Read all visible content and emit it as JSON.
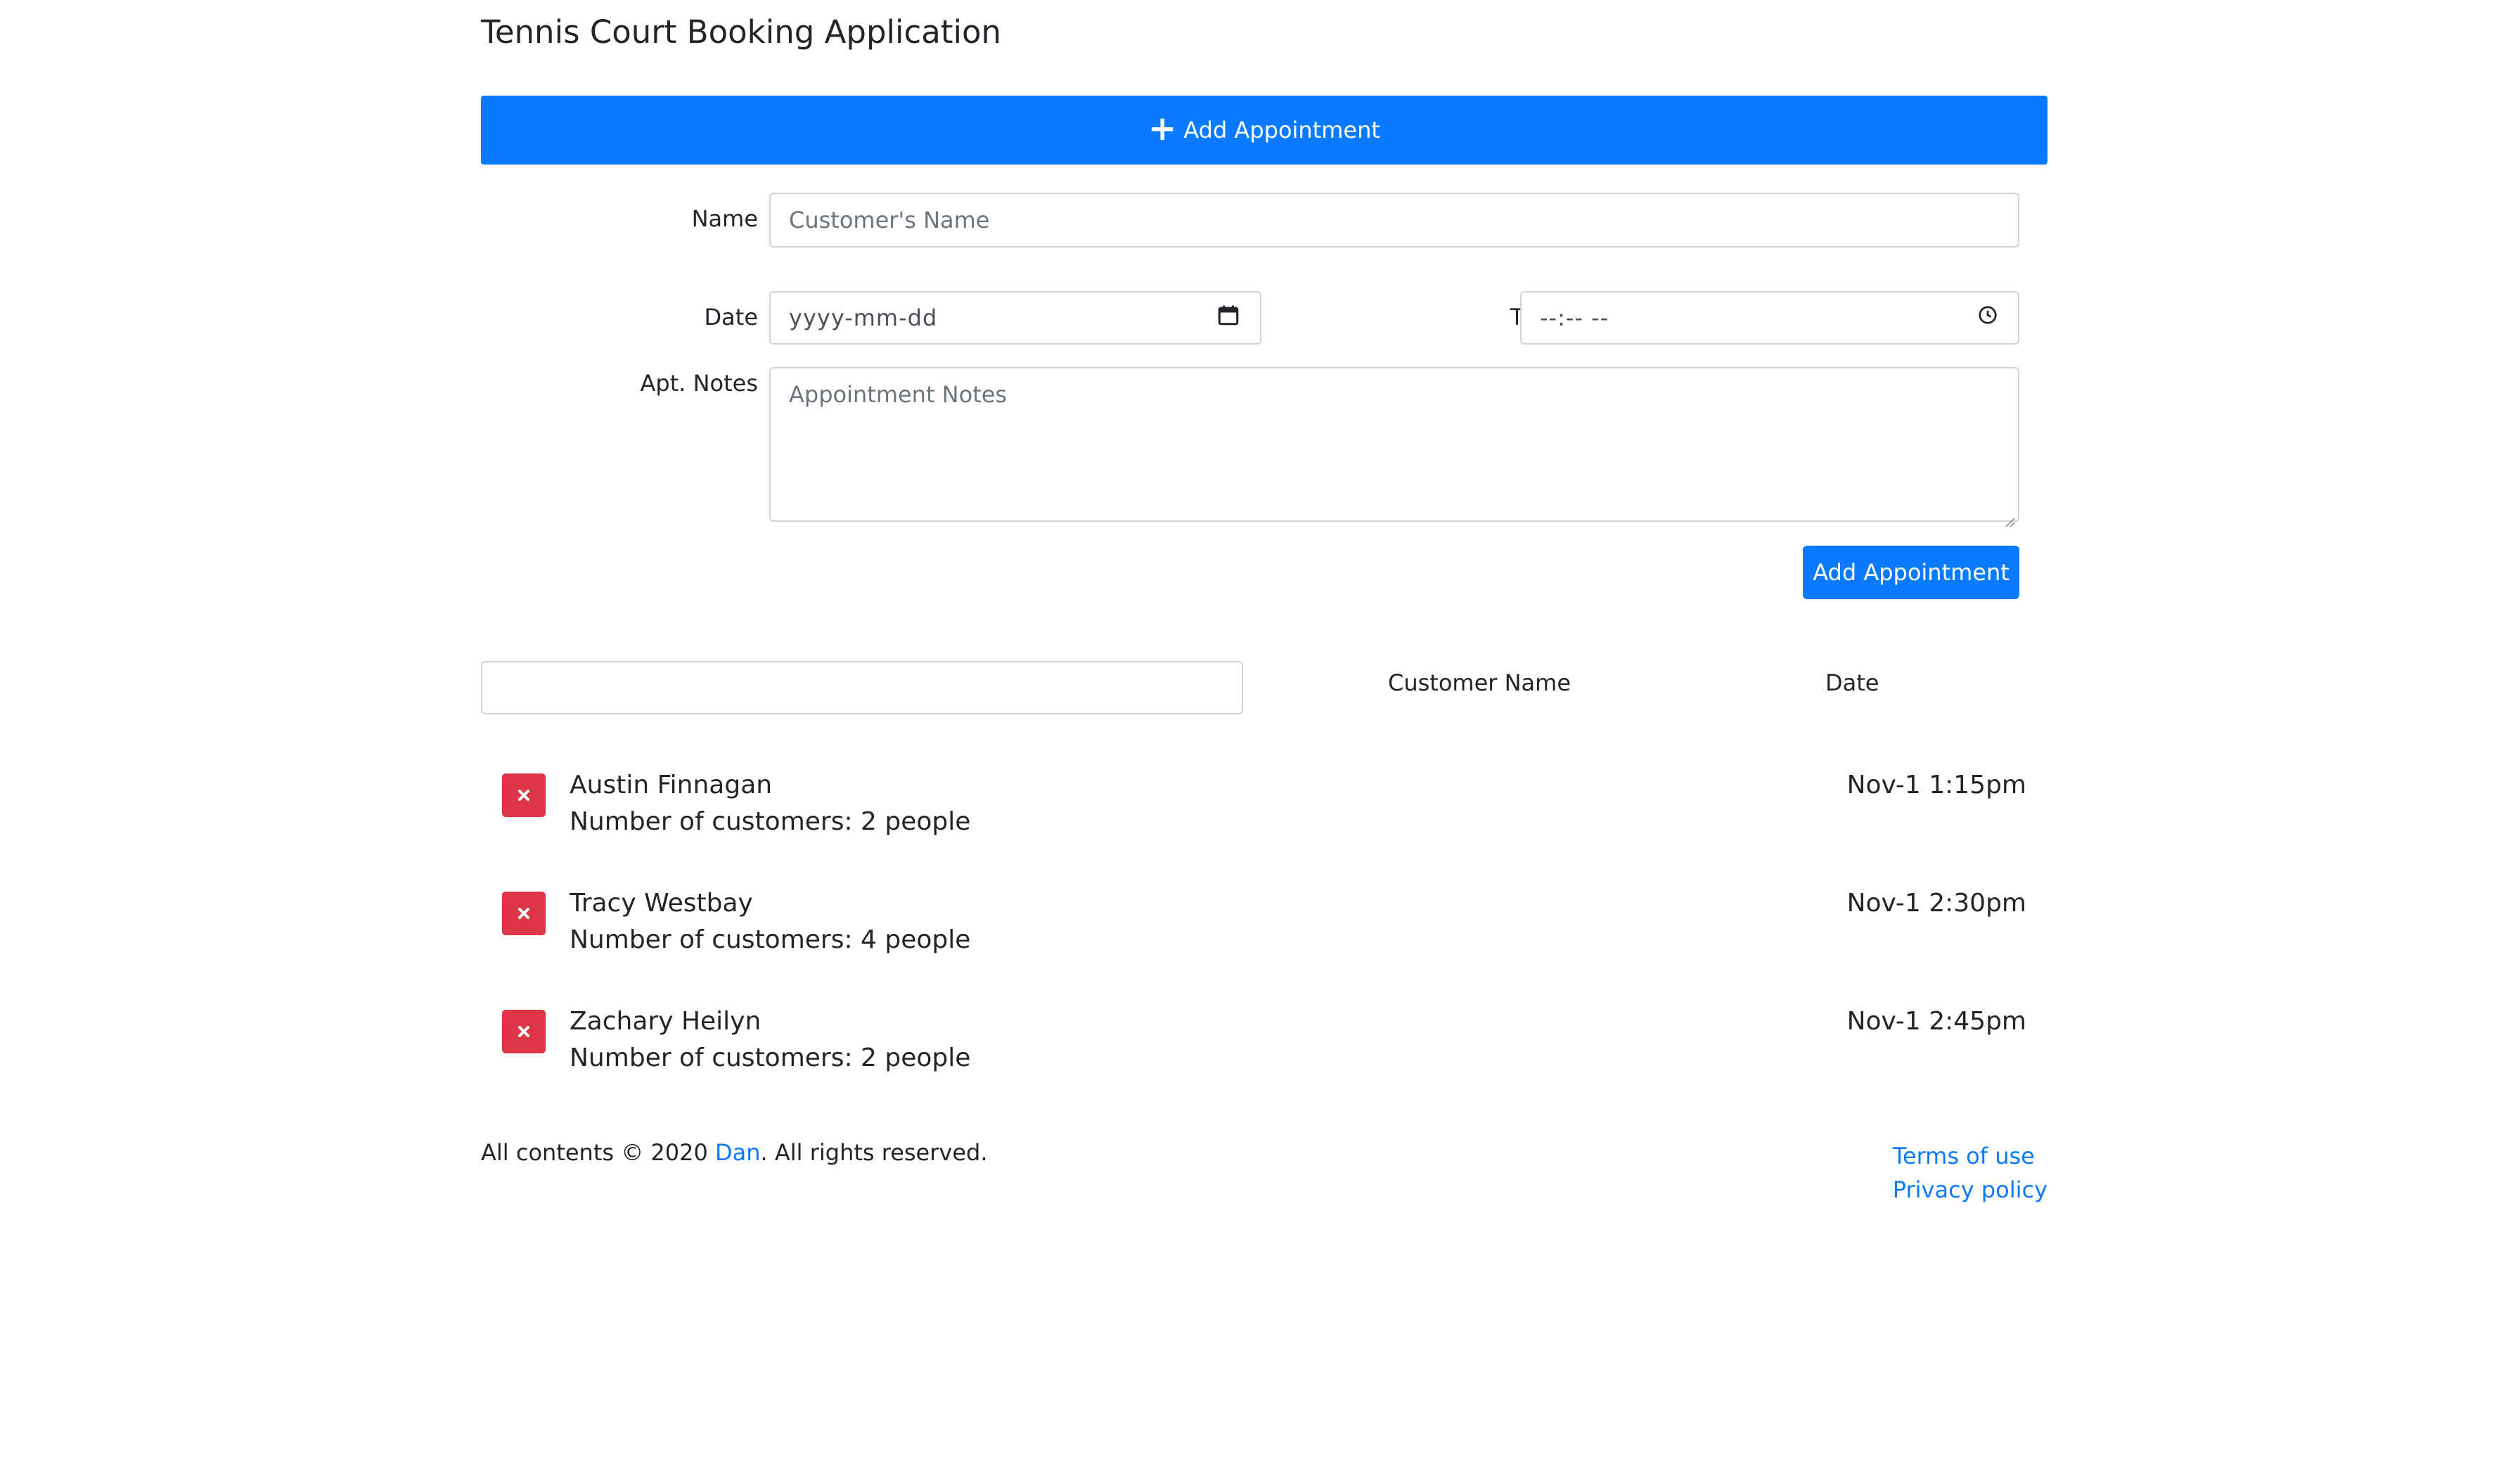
{
  "app": {
    "title": "Tennis Court Booking Application"
  },
  "add_panel": {
    "toggle_label": "Add Appointment",
    "name_label": "Name",
    "name_placeholder": "Customer's Name",
    "date_label": "Date",
    "date_placeholder": "yyyy-mm-dd",
    "time_label": "Time",
    "time_placeholder": "--:-- --",
    "notes_label": "Apt. Notes",
    "notes_placeholder": "Appointment Notes",
    "submit_label": "Add Appointment"
  },
  "list_controls": {
    "search_value": "",
    "sort_name_label": "Customer Name",
    "sort_date_label": "Date"
  },
  "appointments": [
    {
      "name": "Austin Finnagan",
      "count": "Number of customers: 2 people",
      "date": "Nov-1 1:15pm"
    },
    {
      "name": "Tracy Westbay",
      "count": "Number of customers: 4 people",
      "date": "Nov-1 2:30pm"
    },
    {
      "name": "Zachary Heilyn",
      "count": "Number of customers: 2 people",
      "date": "Nov-1 2:45pm"
    }
  ],
  "footer": {
    "prefix": "All contents © 2020 ",
    "author": "Dan",
    "suffix": ". All rights reserved.",
    "terms": "Terms of use",
    "privacy": "Privacy policy"
  },
  "colors": {
    "primary": "#0a7bff",
    "danger": "#dc3545",
    "border": "#ced4da",
    "text": "#212529",
    "placeholder": "#6c757d"
  },
  "icons": {
    "toggle": "plus-icon",
    "date": "calendar-icon",
    "time": "clock-icon",
    "delete": "close-icon"
  }
}
